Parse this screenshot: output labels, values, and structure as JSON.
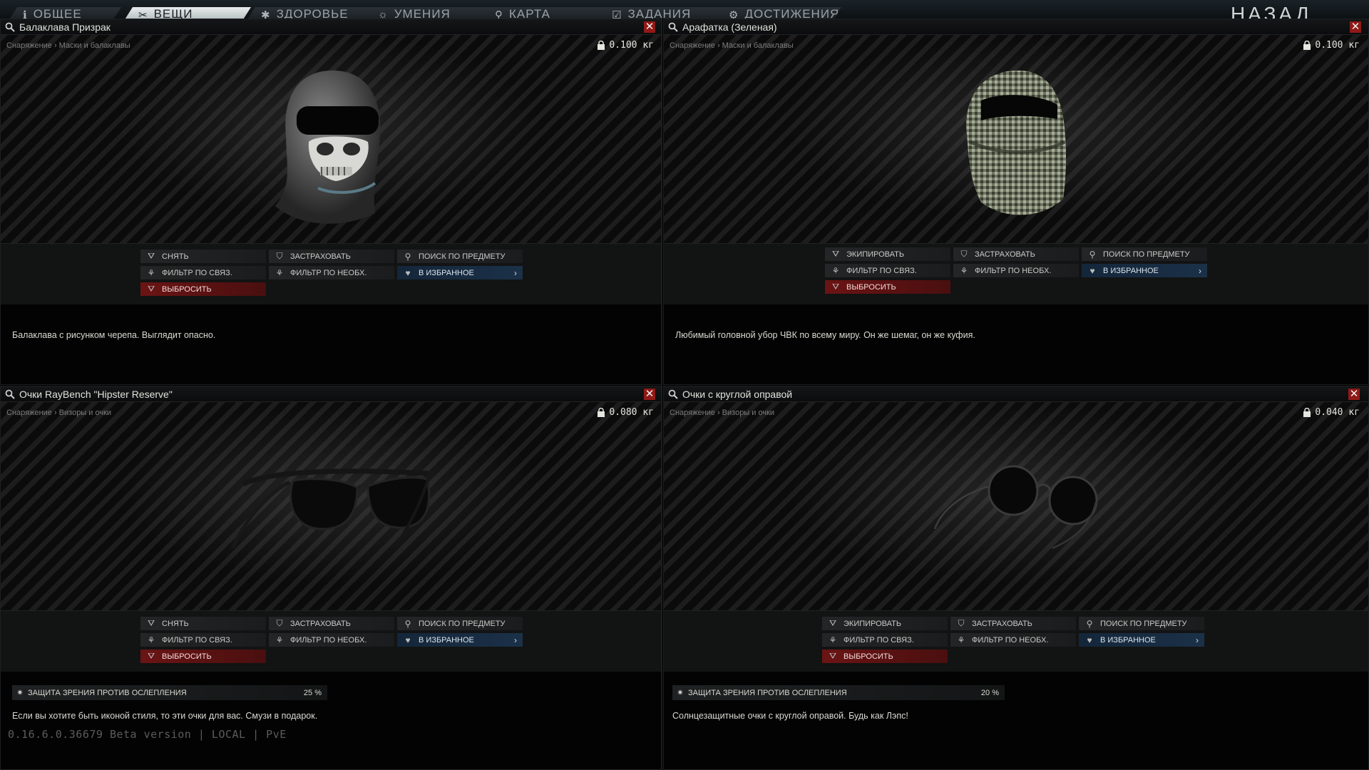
{
  "nav": {
    "tabs": [
      {
        "label": "ОБЩЕЕ",
        "icon": "info-icon"
      },
      {
        "label": "ВЕЩИ",
        "icon": "wrench-icon"
      },
      {
        "label": "ЗДОРОВЬЕ",
        "icon": "health-icon"
      },
      {
        "label": "УМЕНИЯ",
        "icon": "skills-icon"
      },
      {
        "label": "КАРТА",
        "icon": "map-pin-icon"
      },
      {
        "label": "ЗАДАНИЯ",
        "icon": "tasks-icon"
      },
      {
        "label": "ДОСТИЖЕНИЯ",
        "icon": "achievements-icon"
      }
    ],
    "active_tab": "ВЕЩИ",
    "back_label": "НАЗАД"
  },
  "actions_labels": {
    "remove": "СНЯТЬ",
    "equip": "ЭКИПИРОВАТЬ",
    "insure": "ЗАСТРАХОВАТЬ",
    "search": "ПОИСК ПО ПРЕДМЕТУ",
    "filter_linked": "ФИЛЬТР ПО СВЯЗ.",
    "filter_required": "ФИЛЬТР ПО НЕОБХ.",
    "favorite": "В ИЗБРАННОЕ",
    "discard": "ВЫБРОСИТЬ"
  },
  "colors": {
    "discard_red": "#6b1414",
    "favorite_blue": "#1b3148",
    "close_red": "#8f1a17",
    "check_yellow": "#d2c22a"
  },
  "panels": [
    {
      "title": "Балаклава Призрак",
      "breadcrumb": "Снаряжение › Маски и балаклавы",
      "weight": "0.100 кг",
      "first_action": "СНЯТЬ",
      "description": "Балаклава с рисунком черепа. Выглядит опасно.",
      "image": "ghost-balaclava-image",
      "equipped": true
    },
    {
      "title": "Арафатка (Зеленая)",
      "breadcrumb": "Снаряжение › Маски и балаклавы",
      "weight": "0.100 кг",
      "first_action": "ЭКИПИРОВАТЬ",
      "description": "Любимый головной убор ЧВК по всему миру. Он же шемаг, он же куфия.",
      "image": "shemagh-image",
      "equipped": true
    },
    {
      "title": "Очки RayBench \"Hipster Reserve\"",
      "breadcrumb": "Снаряжение › Визоры и очки",
      "weight": "0.080 кг",
      "first_action": "СНЯТЬ",
      "stat_label": "ЗАЩИТА ЗРЕНИЯ ПРОТИВ ОСЛЕПЛЕНИЯ",
      "stat_value": "25 %",
      "description": "Если вы хотите быть иконой стиля, то эти очки для вас. Смузи в подарок.",
      "image": "wayfarer-glasses-image",
      "equipped": true
    },
    {
      "title": "Очки с круглой оправой",
      "breadcrumb": "Снаряжение › Визоры и очки",
      "weight": "0.040 кг",
      "first_action": "ЭКИПИРОВАТЬ",
      "stat_label": "ЗАЩИТА ЗРЕНИЯ ПРОТИВ ОСЛЕПЛЕНИЯ",
      "stat_value": "20 %",
      "description": "Солнцезащитные очки с круглой оправой. Будь как Лэпс!",
      "image": "round-glasses-image",
      "equipped": false
    }
  ],
  "version": "0.16.6.0.36679 Beta version | LOCAL | PvE"
}
